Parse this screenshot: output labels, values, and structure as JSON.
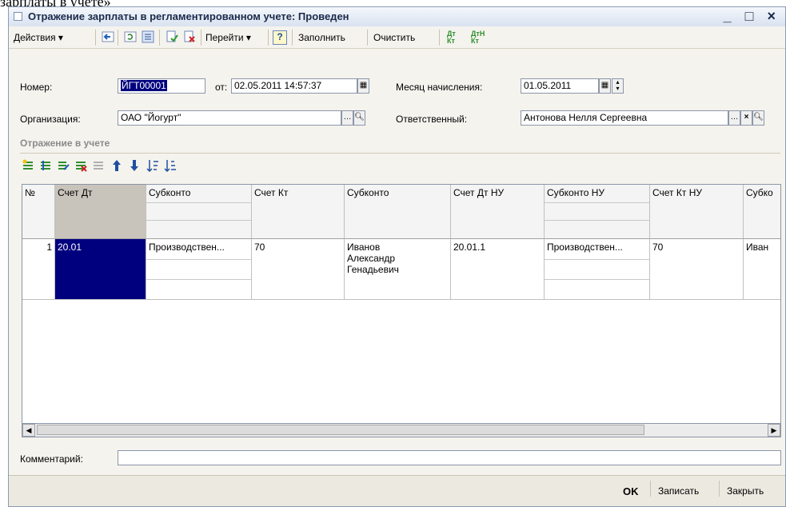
{
  "caption": "зарплаты в учете»",
  "window": {
    "title": "Отражение зарплаты в регламентированном учете: Проведен",
    "controls": "_ □ ×"
  },
  "toolbar": {
    "actions_label": "Действия ▾",
    "goto_label": "Перейти ▾",
    "help_label": "?",
    "fill_label": "Заполнить",
    "clear_label": "Очистить",
    "dt_kt_label": "Дт Кт",
    "dt_kt_n_label": "ДтН Кт"
  },
  "form": {
    "number_label": "Номер:",
    "number_value": "ЙГТ00001",
    "from_label": "от:",
    "date_value": "02.05.2011 14:57:37",
    "month_label": "Месяц начисления:",
    "month_value": "01.05.2011",
    "org_label": "Организация:",
    "org_value": "ОАО \"Йогурт\"",
    "resp_label": "Ответственный:",
    "resp_value": "Антонова Нелля Сергеевна",
    "comment_label": "Комментарий:",
    "comment_value": ""
  },
  "section_title": "Отражение в учете",
  "table": {
    "headers": [
      "№",
      "Счет Дт",
      "Субконто",
      "Счет Кт",
      "Субконто",
      "Счет Дт НУ",
      "Субконто НУ",
      "Счет Кт НУ",
      "Субко"
    ],
    "row": {
      "num": "1",
      "dt": "20.01",
      "sub1": "Производствен...",
      "kt": "70",
      "sub2_line1": "Иванов",
      "sub2_line2": "Александр",
      "sub2_line3": "Генадьевич",
      "dt_nu": "20.01.1",
      "sub_nu": "Производствен...",
      "kt_nu": "70",
      "sub_last": "Иван"
    }
  },
  "footer": {
    "ok_label": "OK",
    "save_label": "Записать",
    "close_label": "Закрыть"
  },
  "colors": {
    "selection": "#00007f",
    "title_text": "#1b2a4a",
    "section_text": "#8a8a8a"
  }
}
